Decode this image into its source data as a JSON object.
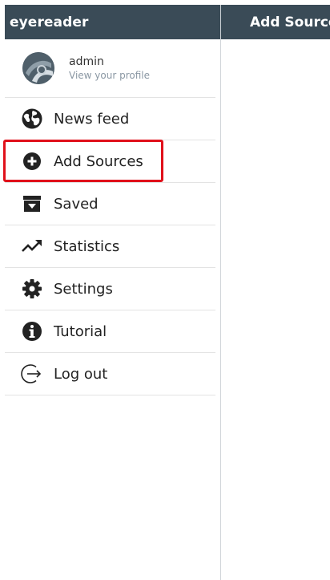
{
  "drawer": {
    "brand": "eyereader",
    "profile": {
      "name": "admin",
      "link": "View your profile"
    },
    "items": [
      {
        "id": "news-feed",
        "label": "News feed",
        "icon": "globe-icon"
      },
      {
        "id": "add-sources",
        "label": "Add Sources",
        "icon": "plus-circle-icon"
      },
      {
        "id": "saved",
        "label": "Saved",
        "icon": "archive-icon"
      },
      {
        "id": "statistics",
        "label": "Statistics",
        "icon": "trend-up-icon"
      },
      {
        "id": "settings",
        "label": "Settings",
        "icon": "gear-icon"
      },
      {
        "id": "tutorial",
        "label": "Tutorial",
        "icon": "info-icon"
      },
      {
        "id": "log-out",
        "label": "Log out",
        "icon": "logout-icon"
      }
    ]
  },
  "topbar": {
    "title": "Add Sources"
  },
  "colors": {
    "header_bg": "#3a4b57",
    "highlight": "#e0101a",
    "muted_text": "#8a97a3"
  }
}
